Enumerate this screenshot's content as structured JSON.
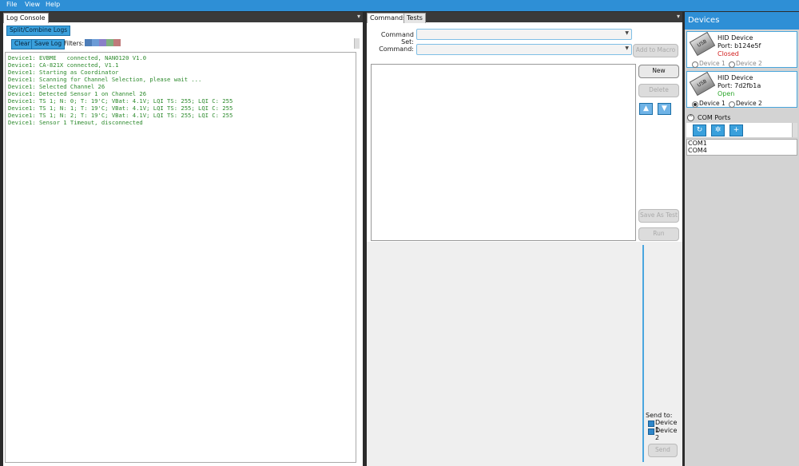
{
  "menu": [
    "File",
    "View",
    "Help"
  ],
  "log_panel": {
    "tab_label": "Log Console",
    "split_button": "Split/Combine Logs",
    "clear_button": "Clear",
    "save_button": "Save Log",
    "filters_label": "Filters:",
    "filter_colors": [
      "#4d7db8",
      "#6b9bd6",
      "#8a7fc8",
      "#7fb07f",
      "#c07a7a"
    ],
    "lines": [
      "Device1: EVBME   connected, NANO120 V1.0",
      "Device1: CA-821X connected, V1.1",
      "Device1: Starting as Coordinator",
      "Device1: Scanning for Channel Selection, please wait ...",
      "Device1: Selected Channel 26",
      "Device1: Detected Sensor 1 on Channel 26",
      "Device1: TS 1; N: 0; T: 19'C; VBat: 4.1V; LQI TS: 255; LQI C: 255",
      "Device1: TS 1; N: 1; T: 19'C; VBat: 4.1V; LQI TS: 255; LQI C: 255",
      "Device1: TS 1; N: 2; T: 19'C; VBat: 4.1V; LQI TS: 255; LQI C: 255",
      "Device1: Sensor 1 Timeout, disconnected"
    ]
  },
  "commands_panel": {
    "tabs": [
      "Commands",
      "Tests"
    ],
    "command_set_label": "Command Set:",
    "command_label": "Command:",
    "add_to_macro": "Add to Macro",
    "new_button": "New",
    "delete_button": "Delete",
    "save_as_test": "Save As Test",
    "run_button": "Run",
    "send_to_label": "Send to:",
    "send_targets": [
      "Device 1",
      "Device 2"
    ],
    "send_button": "Send"
  },
  "devices_panel": {
    "title": "Devices",
    "usb_glyph": "USB",
    "devices": [
      {
        "name": "HID Device",
        "port": "Port: b124e5f",
        "status": "Closed",
        "status_color": "#d22020",
        "selected": "none"
      },
      {
        "name": "HID Device",
        "port": "Port: 7d2fb1a",
        "status": "Open",
        "status_color": "#2aa52a",
        "selected": "Device 1"
      }
    ],
    "radio_labels": [
      "Device 1",
      "Device 2"
    ],
    "com_ports_label": "COM Ports",
    "com_ports": [
      "COM1",
      "COM4"
    ]
  },
  "colors": {
    "accent": "#2e8fd6",
    "log_text": "#2c8a2c"
  }
}
